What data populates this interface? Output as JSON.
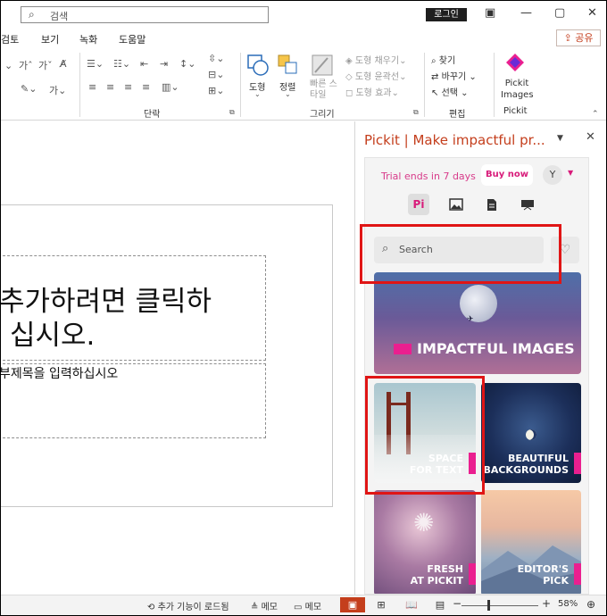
{
  "titlebar": {
    "search_placeholder": "검색",
    "login_label": "로그인",
    "controls": {
      "ribbon_display": "▣",
      "minimize": "—",
      "maximize": "▢",
      "close": "✕"
    }
  },
  "menu": {
    "items": [
      "검토",
      "보기",
      "녹화",
      "도움말"
    ],
    "share_label": "공유"
  },
  "ribbon": {
    "groups": {
      "paragraph": "단락",
      "drawing": "그리기",
      "editing": "편집",
      "pickit": "Pickit"
    },
    "shape_label": "도형",
    "arrange_label": "정렬",
    "quick_style_label": "빠른 스타일",
    "shape_fill": "도형 채우기",
    "shape_outline": "도형 윤곽선",
    "shape_effects": "도형 효과",
    "find_label": "찾기",
    "replace_label": "바꾸기",
    "select_label": "선택",
    "pickit_images_label": "Pickit Images"
  },
  "slide": {
    "title_line1": "추가하려면 클릭하",
    "title_line2": "십시오.",
    "subtitle": "부제목을 입력하십시오"
  },
  "pane": {
    "title": "Pickit | Make impactful pr...",
    "trial_text": "Trial ends in 7 days",
    "buy_label": "Buy now",
    "avatar_initial": "Y",
    "search_placeholder": "Search",
    "cards": [
      {
        "label": "IMPACTFUL IMAGES"
      },
      {
        "line1": "SPACE",
        "line2": "FOR TEXT"
      },
      {
        "line1": "BEAUTIFUL",
        "line2": "BACKGROUNDS"
      },
      {
        "line1": "FRESH",
        "line2": "AT PICKIT"
      },
      {
        "line1": "EDITOR'S",
        "line2": "PICK"
      }
    ],
    "accent_color": "#ea1f8f"
  },
  "status": {
    "addin_loading": "추가 기능이 로드됨",
    "notes_label": "메모",
    "comments_label": "메모",
    "zoom": "58%"
  }
}
